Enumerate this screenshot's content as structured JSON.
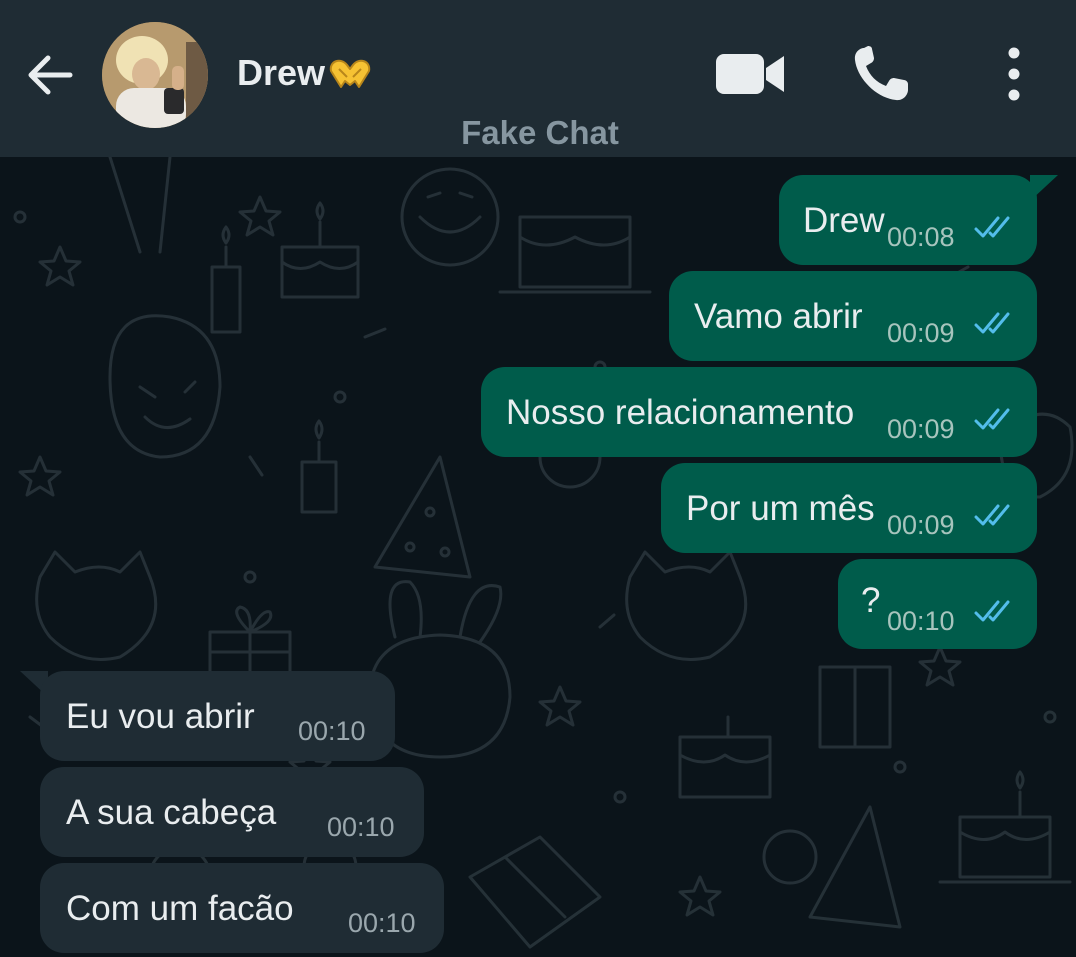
{
  "header": {
    "contact_name": "Drew",
    "contact_emoji": "heart-hands-emoji",
    "subtitle": "Fake Chat",
    "icons": [
      "back-arrow-icon",
      "video-call-icon",
      "phone-call-icon",
      "more-options-icon"
    ]
  },
  "colors": {
    "header_bg": "#1f2c34",
    "chat_bg": "#0b141a",
    "outgoing_bubble": "#005c4b",
    "incoming_bubble": "#1f2c34",
    "read_tick": "#53bdeb",
    "muted_text": "#8696a0"
  },
  "messages": [
    {
      "direction": "out",
      "text": "Drew",
      "time": "00:08",
      "status": "read"
    },
    {
      "direction": "out",
      "text": "Vamo abrir",
      "time": "00:09",
      "status": "read"
    },
    {
      "direction": "out",
      "text": "Nosso relacionamento",
      "time": "00:09",
      "status": "read"
    },
    {
      "direction": "out",
      "text": "Por um mês",
      "time": "00:09",
      "status": "read"
    },
    {
      "direction": "out",
      "text": "?",
      "time": "00:10",
      "status": "read"
    },
    {
      "direction": "in",
      "text": "Eu vou abrir",
      "time": "00:10"
    },
    {
      "direction": "in",
      "text": "A sua cabeça",
      "time": "00:10"
    },
    {
      "direction": "in",
      "text": "Com um facão",
      "time": "00:10"
    }
  ]
}
